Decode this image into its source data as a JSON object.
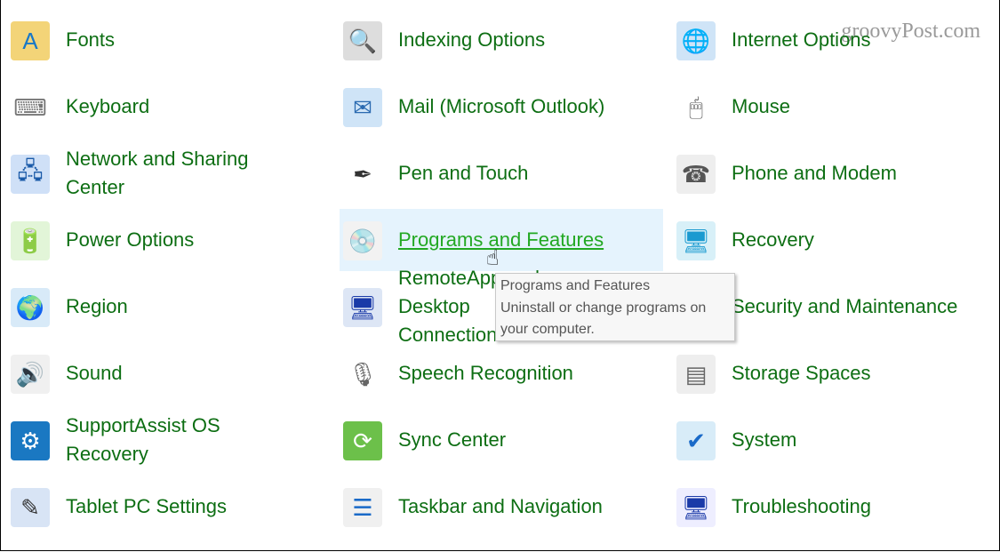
{
  "watermark": "groovyPost.com",
  "items": [
    {
      "label": "Fonts",
      "icon": "fonts-icon",
      "glyph": "A",
      "bg": "#f3d478",
      "fg": "#1878c8"
    },
    {
      "label": "Indexing Options",
      "icon": "indexing-options-icon",
      "glyph": "🔍",
      "bg": "#ddd",
      "fg": "#555"
    },
    {
      "label": "Internet Options",
      "icon": "internet-options-icon",
      "glyph": "🌐",
      "bg": "#cfe4f7",
      "fg": "#2a7a2a"
    },
    {
      "label": "Keyboard",
      "icon": "keyboard-icon",
      "glyph": "⌨",
      "bg": "#fff",
      "fg": "#777"
    },
    {
      "label": "Mail (Microsoft Outlook)",
      "icon": "mail-icon",
      "glyph": "✉",
      "bg": "#cfe4f7",
      "fg": "#2a6ab0"
    },
    {
      "label": "Mouse",
      "icon": "mouse-icon",
      "glyph": "🖱",
      "bg": "#fff",
      "fg": "#555"
    },
    {
      "label": "Network and Sharing Center",
      "icon": "network-icon",
      "glyph": "🖧",
      "bg": "#cfe0f7",
      "fg": "#1a5aa8"
    },
    {
      "label": "Pen and Touch",
      "icon": "pen-icon",
      "glyph": "✒",
      "bg": "#fff",
      "fg": "#333"
    },
    {
      "label": "Phone and Modem",
      "icon": "phone-icon",
      "glyph": "☎",
      "bg": "#eee",
      "fg": "#555"
    },
    {
      "label": "Power Options",
      "icon": "power-options-icon",
      "glyph": "🔋",
      "bg": "#e2f5d8",
      "fg": "#2a8a2a"
    },
    {
      "label": "Programs and Features",
      "icon": "programs-features-icon",
      "glyph": "💿",
      "bg": "#f2f2f2",
      "fg": "#1a6ac8"
    },
    {
      "label": "Recovery",
      "icon": "recovery-icon",
      "glyph": "🖥",
      "bg": "#d8f0f8",
      "fg": "#1a9ad0"
    },
    {
      "label": "Region",
      "icon": "region-icon",
      "glyph": "🌍",
      "bg": "#d8eaf8",
      "fg": "#2a7a2a"
    },
    {
      "label": "RemoteApp and Desktop Connections",
      "icon": "remoteapp-icon",
      "glyph": "🖥",
      "bg": "#dde6f5",
      "fg": "#1a3aa8"
    },
    {
      "label": "Security and Maintenance",
      "icon": "security-icon",
      "glyph": "⚑",
      "bg": "#e4edf8",
      "fg": "#1a5aa8"
    },
    {
      "label": "Sound",
      "icon": "sound-icon",
      "glyph": "🔊",
      "bg": "#f0f0f0",
      "fg": "#666"
    },
    {
      "label": "Speech Recognition",
      "icon": "microphone-icon",
      "glyph": "🎙",
      "bg": "#fff",
      "fg": "#666"
    },
    {
      "label": "Storage Spaces",
      "icon": "storage-spaces-icon",
      "glyph": "▤",
      "bg": "#eee",
      "fg": "#666"
    },
    {
      "label": "SupportAssist OS Recovery",
      "icon": "supportassist-icon",
      "glyph": "⚙",
      "bg": "#1a78c2",
      "fg": "#fff"
    },
    {
      "label": "Sync Center",
      "icon": "sync-center-icon",
      "glyph": "⟳",
      "bg": "#6cc04a",
      "fg": "#fff"
    },
    {
      "label": "System",
      "icon": "system-icon",
      "glyph": "✔",
      "bg": "#d8ecf8",
      "fg": "#1a6ac8"
    },
    {
      "label": "Tablet PC Settings",
      "icon": "tablet-icon",
      "glyph": "✎",
      "bg": "#d8e4f5",
      "fg": "#333"
    },
    {
      "label": "Taskbar and Navigation",
      "icon": "taskbar-icon",
      "glyph": "☰",
      "bg": "#f0f0f0",
      "fg": "#1a6ac8"
    },
    {
      "label": "Troubleshooting",
      "icon": "troubleshooting-icon",
      "glyph": "🖥",
      "bg": "#eef",
      "fg": "#1a3aa8"
    }
  ],
  "hovered": "Programs and Features",
  "tooltip": {
    "title": "Programs and Features",
    "description": "Uninstall or change programs on your computer."
  }
}
